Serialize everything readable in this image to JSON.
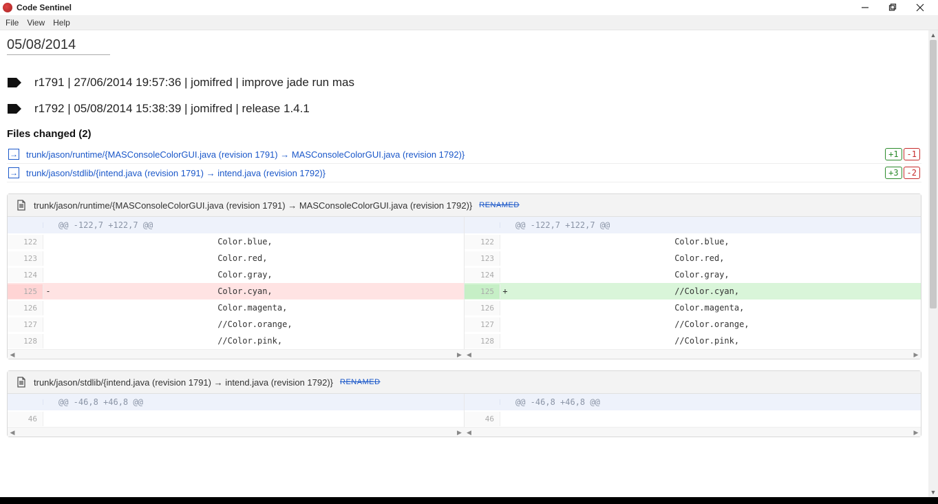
{
  "window": {
    "title": "Code Sentinel"
  },
  "menubar": {
    "file": "File",
    "view": "View",
    "help": "Help"
  },
  "dateHeader": "05/08/2014",
  "commits": [
    {
      "text": "r1791 | 27/06/2014 19:57:36 | jomifred | improve jade run mas"
    },
    {
      "text": "r1792 | 05/08/2014 15:38:39 | jomifred | release 1.4.1"
    }
  ],
  "filesChanged": {
    "header": "Files changed (2)",
    "items": [
      {
        "link": "trunk/jason/runtime/{MASConsoleColorGUI.java (revision 1791) → MASConsoleColorGUI.java (revision 1792)}",
        "add": "+1",
        "del": "-1"
      },
      {
        "link": "trunk/jason/stdlib/{intend.java (revision 1791) → intend.java (revision 1792)}",
        "add": "+3",
        "del": "-2"
      }
    ]
  },
  "diffs": [
    {
      "header": "trunk/jason/runtime/{MASConsoleColorGUI.java (revision 1791) → MASConsoleColorGUI.java (revision 1792)}",
      "renamed": "RENAMED",
      "hunk": "@@ -122,7 +122,7 @@",
      "left": [
        {
          "ln": "122",
          "marker": "",
          "code": "                                Color.blue,",
          "cls": ""
        },
        {
          "ln": "123",
          "marker": "",
          "code": "                                Color.red,",
          "cls": ""
        },
        {
          "ln": "124",
          "marker": "",
          "code": "                                Color.gray,",
          "cls": ""
        },
        {
          "ln": "125",
          "marker": "-",
          "code": "                                Color.cyan,",
          "cls": "row-del"
        },
        {
          "ln": "126",
          "marker": "",
          "code": "                                Color.magenta,",
          "cls": ""
        },
        {
          "ln": "127",
          "marker": "",
          "code": "                                //Color.orange,",
          "cls": ""
        },
        {
          "ln": "128",
          "marker": "",
          "code": "                                //Color.pink,",
          "cls": ""
        }
      ],
      "right": [
        {
          "ln": "122",
          "marker": "",
          "code": "                                Color.blue,",
          "cls": ""
        },
        {
          "ln": "123",
          "marker": "",
          "code": "                                Color.red,",
          "cls": ""
        },
        {
          "ln": "124",
          "marker": "",
          "code": "                                Color.gray,",
          "cls": ""
        },
        {
          "ln": "125",
          "marker": "+",
          "code": "                                //Color.cyan,",
          "cls": "row-add"
        },
        {
          "ln": "126",
          "marker": "",
          "code": "                                Color.magenta,",
          "cls": ""
        },
        {
          "ln": "127",
          "marker": "",
          "code": "                                //Color.orange,",
          "cls": ""
        },
        {
          "ln": "128",
          "marker": "",
          "code": "                                //Color.pink,",
          "cls": ""
        }
      ]
    },
    {
      "header": "trunk/jason/stdlib/{intend.java (revision 1791) → intend.java (revision 1792)}",
      "renamed": "RENAMED",
      "hunk": "@@ -46,8 +46,8 @@",
      "left": [
        {
          "ln": "46",
          "marker": "",
          "code": "",
          "cls": ""
        }
      ],
      "right": [
        {
          "ln": "46",
          "marker": "",
          "code": "",
          "cls": ""
        }
      ]
    }
  ]
}
